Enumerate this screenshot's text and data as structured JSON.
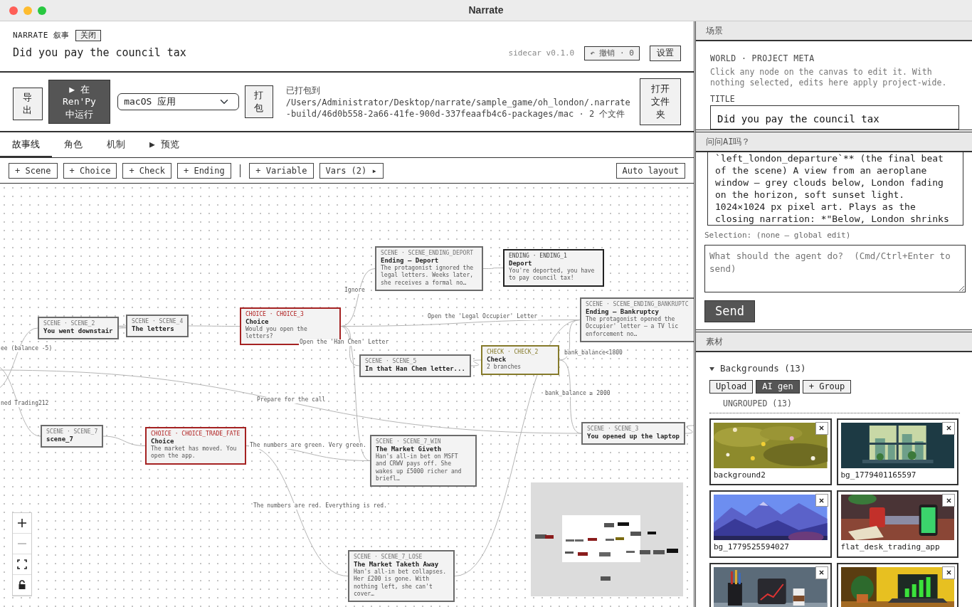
{
  "window": {
    "title": "Narrate"
  },
  "header": {
    "brand": "NARRATE 叙事",
    "close_button": "关闭",
    "project_title": "Did you pay the council tax",
    "version": "sidecar v0.1.0",
    "undo_button": "↶ 撤销 · 0",
    "settings_button": "设置"
  },
  "build_bar": {
    "export_button": "导出",
    "run_button": "▶ 在 Ren'Py 中运行",
    "target_select": "macOS 应用",
    "package_button": "打包",
    "status_label": "已打包到",
    "status_path": "/Users/Administrator/Desktop/narrate/sample_game/oh_london/.narrate-build/46d0b558-2a66-41fe-900d-337feaafb4c6-packages/mac · 2 个文件",
    "open_folder_button": "打开文件夹"
  },
  "tabs": [
    {
      "label": "故事线",
      "selected": true
    },
    {
      "label": "角色",
      "selected": false
    },
    {
      "label": "机制",
      "selected": false
    },
    {
      "label": "▶ 预览",
      "selected": false
    }
  ],
  "canvas_toolbar": {
    "add_buttons": [
      "+ Scene",
      "+ Choice",
      "+ Check",
      "+ Ending"
    ],
    "variable_buttons": [
      "+ Variable",
      "Vars (2) ▸"
    ],
    "layout_button": "Auto layout"
  },
  "nodes": [
    {
      "kind": "scene",
      "tag": "SCENE · SCENE_2",
      "title": "You went downstair"
    },
    {
      "kind": "scene",
      "tag": "SCENE · SCENE_4",
      "title": "The letters"
    },
    {
      "kind": "choice",
      "tag": "CHOICE · CHOICE_3",
      "title": "Choice",
      "desc": "Would you open the letters?"
    },
    {
      "kind": "scene",
      "tag": "SCENE · SCENE_ENDING_DEPORT",
      "title": "Ending — Deport",
      "desc": "The protagonist ignored the legal letters. Weeks later, she receives a formal no…"
    },
    {
      "kind": "ending",
      "tag": "ENDING · ENDING_1",
      "title": "Deport",
      "desc": "You're deported, you have to pay council tax!"
    },
    {
      "kind": "scene",
      "tag": "SCENE · SCENE_ENDING_BANKRUPTC",
      "title": "Ending — Bankruptcy",
      "desc": "The protagonist opened the Occupier' letter — a TV lic enforcement no…"
    },
    {
      "kind": "scene",
      "tag": "SCENE · SCENE_5",
      "title": "In that Han Chen letter..."
    },
    {
      "kind": "check",
      "tag": "CHECK · CHECK_2",
      "title": "Check",
      "desc": "2 branches"
    },
    {
      "kind": "scene",
      "tag": "SCENE · SCENE_3",
      "title": "You opened up the laptop"
    },
    {
      "kind": "scene",
      "tag": "SCENE · SCENE_7",
      "title": "scene_7"
    },
    {
      "kind": "choice",
      "tag": "CHOICE · CHOICE_TRADE_FATE",
      "title": "Choice",
      "desc": "The market has moved. You open the app."
    },
    {
      "kind": "scene",
      "tag": "SCENE · SCENE_7_WIN",
      "title": "The Market Giveth",
      "desc": "Han's all-in bet on MSFT and CRWV pays off. She wakes up £5000 richer and briefl…"
    },
    {
      "kind": "scene",
      "tag": "SCENE · SCENE_7_LOSE",
      "title": "The Market Taketh Away",
      "desc": "Han's all-in bet collapses. Her £200 is gone. With nothing left, she can't cover…"
    }
  ],
  "edge_labels": [
    "ee (balance -5)",
    "Ignore",
    "Open the 'Legal Occupier' Letter",
    "Open the 'Han Chen' Letter",
    "bank_balance<1800",
    "bank_balance ≥ 2000",
    "Prepare for the call",
    "ned Trading212",
    "The numbers are green. Very green.",
    "The numbers are red. Everything is red."
  ],
  "inspector": {
    "header": "场景",
    "section": "WORLD · PROJECT META",
    "hint": "Click any node on the canvas to edit it. With nothing selected, edits here apply project-wide.",
    "field_label": "TITLE",
    "title_value": "Did you pay the council tax"
  },
  "assistant": {
    "header": "问问AI吗？",
    "transcript": "`left_london_departure`** (the final beat of the scene) A view from an aeroplane window — grey clouds below, London fading on the horizon, soft sunset light. 1024×1024 px pixel art. Plays as the closing narration: *\"Below, London shrinks",
    "selection": "Selection: (none — global edit)",
    "placeholder": "What should the agent do?  (Cmd/Ctrl+Enter to send)",
    "send_button": "Send"
  },
  "assets": {
    "header": "素材",
    "group": {
      "label": "Backgrounds (13)",
      "expanded": true
    },
    "buttons": [
      {
        "label": "Upload",
        "selected": false
      },
      {
        "label": "AI gen",
        "selected": true
      },
      {
        "label": "+ Group",
        "selected": false
      }
    ],
    "subgroup": "UNGROUPED (13)",
    "items": [
      {
        "kind": "picture",
        "name": "background2"
      },
      {
        "kind": "picture",
        "name": "bg_1779401165597"
      },
      {
        "kind": "picture",
        "name": "bg_1779525594027"
      },
      {
        "kind": "picture",
        "name": "flat_desk_trading_app"
      },
      {
        "kind": "picture"
      },
      {
        "kind": "picture"
      }
    ]
  }
}
